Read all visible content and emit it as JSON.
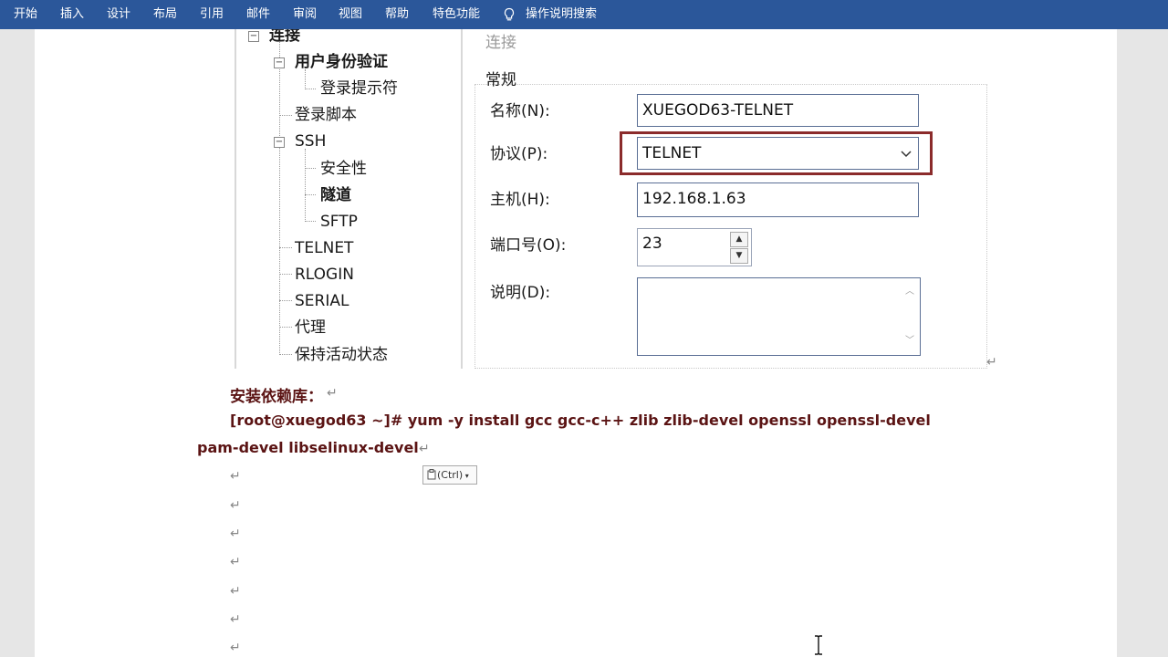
{
  "ribbon": {
    "tabs": [
      "开始",
      "插入",
      "设计",
      "布局",
      "引用",
      "邮件",
      "审阅",
      "视图",
      "帮助",
      "特色功能"
    ],
    "tell_me": "操作说明搜索",
    "icon": "lightbulb-icon"
  },
  "dialog": {
    "tree": {
      "root": "连接",
      "items": [
        {
          "label": "用户身份验证",
          "bold": true
        },
        {
          "label": "登录提示符"
        },
        {
          "label": "登录脚本"
        },
        {
          "label": "SSH"
        },
        {
          "label": "安全性"
        },
        {
          "label": "隧道",
          "bold": true
        },
        {
          "label": "SFTP"
        },
        {
          "label": "TELNET"
        },
        {
          "label": "RLOGIN"
        },
        {
          "label": "SERIAL"
        },
        {
          "label": "代理"
        },
        {
          "label": "保持活动状态"
        }
      ]
    },
    "panel_title": "连接",
    "group_title": "常规",
    "fields": {
      "name_label": "名称(N):",
      "name_value": "XUEGOD63-TELNET",
      "protocol_label": "协议(P):",
      "protocol_value": "TELNET",
      "host_label": "主机(H):",
      "host_value": "192.168.1.63",
      "port_label": "端口号(O):",
      "port_value": "23",
      "desc_label": "说明(D):"
    },
    "highlight_color": "#8b2b2b"
  },
  "document": {
    "heading": "安装依赖库：",
    "command_line1": "[root@xuegod63 ~]# yum -y install gcc gcc-c++ zlib zlib-devel openssl openssl-devel",
    "command_line2": "pam-devel libselinux-devel",
    "paste_options": "(Ctrl)",
    "paragraph_mark": "↵",
    "text_color": "#5b1414"
  }
}
